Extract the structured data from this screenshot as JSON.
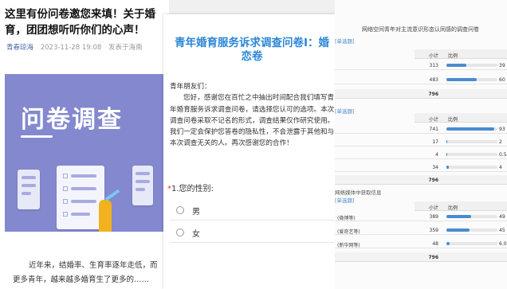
{
  "article": {
    "title": "这里有份问卷邀您来填！关于婚育，团团想听听你们的心声！",
    "account": "青春琼海",
    "date": "2023-11-28 19:08",
    "location": "发表于海南",
    "banner_text": "问卷调查",
    "body": "近年来，结婚率、生育率逐年走低，而更多青年，越来越多婚育生了更多的……"
  },
  "survey": {
    "title": "青年婚育服务诉求调查问卷I：婚恋卷",
    "greeting": "青年朋友们：",
    "intro": "您好，感谢您在百忙之中抽出时间配合我们填写青年婚育服务诉求调查问卷，请选择您认可的选项。本次调查问卷采取不记名的形式，调查结果仅作研究使用。我们一定会保护您答卷的隐私性，不会泄露于其他和与本次调查无关的人。再次感谢您的合作！",
    "question": "1.您的性别:",
    "required_mark": "*",
    "options": [
      "男",
      "女"
    ]
  },
  "results": {
    "title": "网络空间青年对主流意识形态认同感的调查问卷",
    "section1": {
      "tag": "[单选题]",
      "col_count": "小计",
      "col_ratio": "比例",
      "rows": [
        {
          "label": "",
          "count": "313",
          "ratio": 0.39,
          "pct": "39"
        },
        {
          "label": "",
          "count": "483",
          "ratio": 0.6,
          "pct": "60"
        }
      ],
      "total_label": "796",
      "total_prefix": ""
    },
    "section2": {
      "tag": "[单选题]",
      "col_count": "小计",
      "col_ratio": "比例",
      "rows": [
        {
          "label": "",
          "count": "741",
          "ratio": 0.93,
          "pct": "93"
        },
        {
          "label": "",
          "count": "17",
          "ratio": 0.02,
          "pct": "2"
        },
        {
          "label": "",
          "count": "4",
          "ratio": 0.005,
          "pct": "0.5"
        },
        {
          "label": "",
          "count": "34",
          "ratio": 0.04,
          "pct": "4"
        }
      ],
      "total_label": "796"
    },
    "section3": {
      "subtitle": "网络媒体中获取信息",
      "tag": "[单选题]",
      "col_count": "小计",
      "col_ratio": "比例",
      "rows": [
        {
          "label": "(微博等)",
          "count": "389",
          "ratio": 0.49,
          "pct": "49"
        },
        {
          "label": "(爱奇艺等)",
          "count": "359",
          "ratio": 0.45,
          "pct": "45"
        },
        {
          "label": "(新华网等)",
          "count": "48",
          "ratio": 0.06,
          "pct": "6.0"
        }
      ],
      "total_label": "796"
    }
  }
}
